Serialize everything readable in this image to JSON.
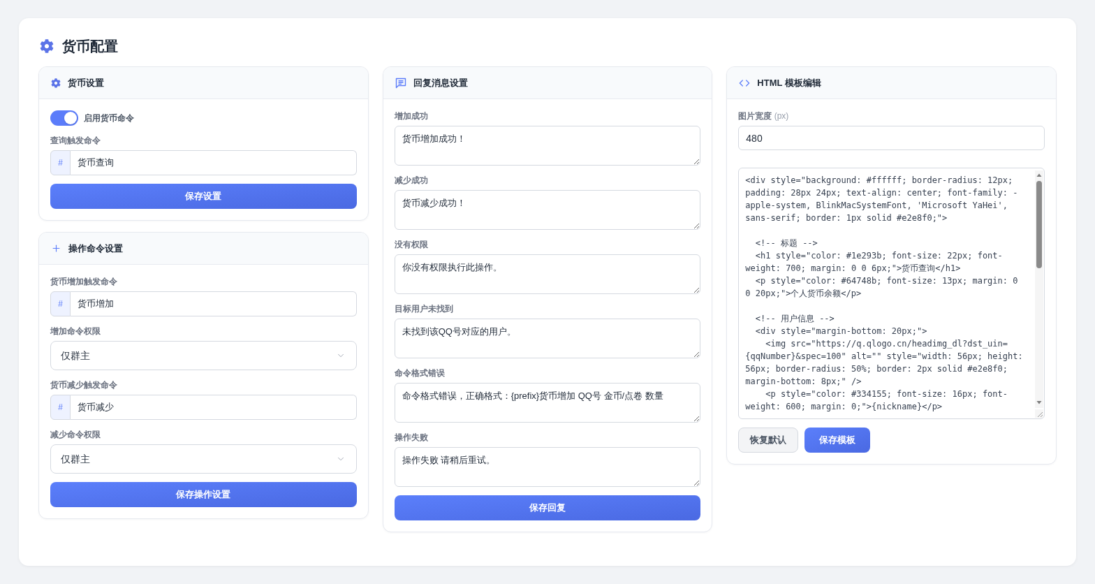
{
  "title": "货币配置",
  "currency_settings": {
    "title": "货币设置",
    "toggle": {
      "label": "启用货币命令",
      "on": true
    },
    "query_command": {
      "label": "查询触发命令",
      "prefix": "#",
      "value": "货币查询"
    },
    "save_button": "保存设置"
  },
  "operation_settings": {
    "title": "操作命令设置",
    "fields": [
      {
        "kind": "command",
        "label": "货币增加触发命令",
        "prefix": "#",
        "value": "货币增加"
      },
      {
        "kind": "select",
        "label": "增加命令权限",
        "value": "仅群主"
      },
      {
        "kind": "command",
        "label": "货币减少触发命令",
        "prefix": "#",
        "value": "货币减少"
      },
      {
        "kind": "select",
        "label": "减少命令权限",
        "value": "仅群主"
      }
    ],
    "save_button": "保存操作设置"
  },
  "reply_settings": {
    "title": "回复消息设置",
    "messages": [
      {
        "label": "增加成功",
        "value": "货币增加成功！"
      },
      {
        "label": "减少成功",
        "value": "货币减少成功！"
      },
      {
        "label": "没有权限",
        "value": "你没有权限执行此操作。"
      },
      {
        "label": "目标用户未找到",
        "value": "未找到该QQ号对应的用户。"
      },
      {
        "label": "命令格式错误",
        "value": "命令格式错误，正确格式：{prefix}货币增加 QQ号 金币/点卷 数量"
      },
      {
        "label": "操作失败",
        "value": "操作失败 请稍后重试。"
      }
    ],
    "save_button": "保存回复"
  },
  "template_editor": {
    "title": "HTML 模板编辑",
    "width_field": {
      "label": "**图片宽度** (px)",
      "value": "480"
    },
    "code": "<div style=\"background: #ffffff; border-radius: 12px; padding: 28px 24px; text-align: center; font-family: -apple-system, BlinkMacSystemFont, 'Microsoft YaHei', sans-serif; border: 1px solid #e2e8f0;\">\n\n  <!-- 标题 -->\n  <h1 style=\"color: #1e293b; font-size: 22px; font-weight: 700; margin: 0 0 6px;\">货币查询</h1>\n  <p style=\"color: #64748b; font-size: 13px; margin: 0 0 20px;\">个人货币余额</p>\n\n  <!-- 用户信息 -->\n  <div style=\"margin-bottom: 20px;\">\n    <img src=\"https://q.qlogo.cn/headimg_dl?dst_uin={qqNumber}&spec=100\" alt=\"\" style=\"width: 56px; height: 56px; border-radius: 50%; border: 2px solid #e2e8f0; margin-bottom: 8px;\" />\n    <p style=\"color: #334155; font-size: 16px; font-weight: 600; margin: 0;\">{nickname}</p>",
    "buttons": [
      {
        "kind": "secondary",
        "label": "恢复默认"
      },
      {
        "kind": "primary",
        "label": "保存模板"
      }
    ]
  }
}
